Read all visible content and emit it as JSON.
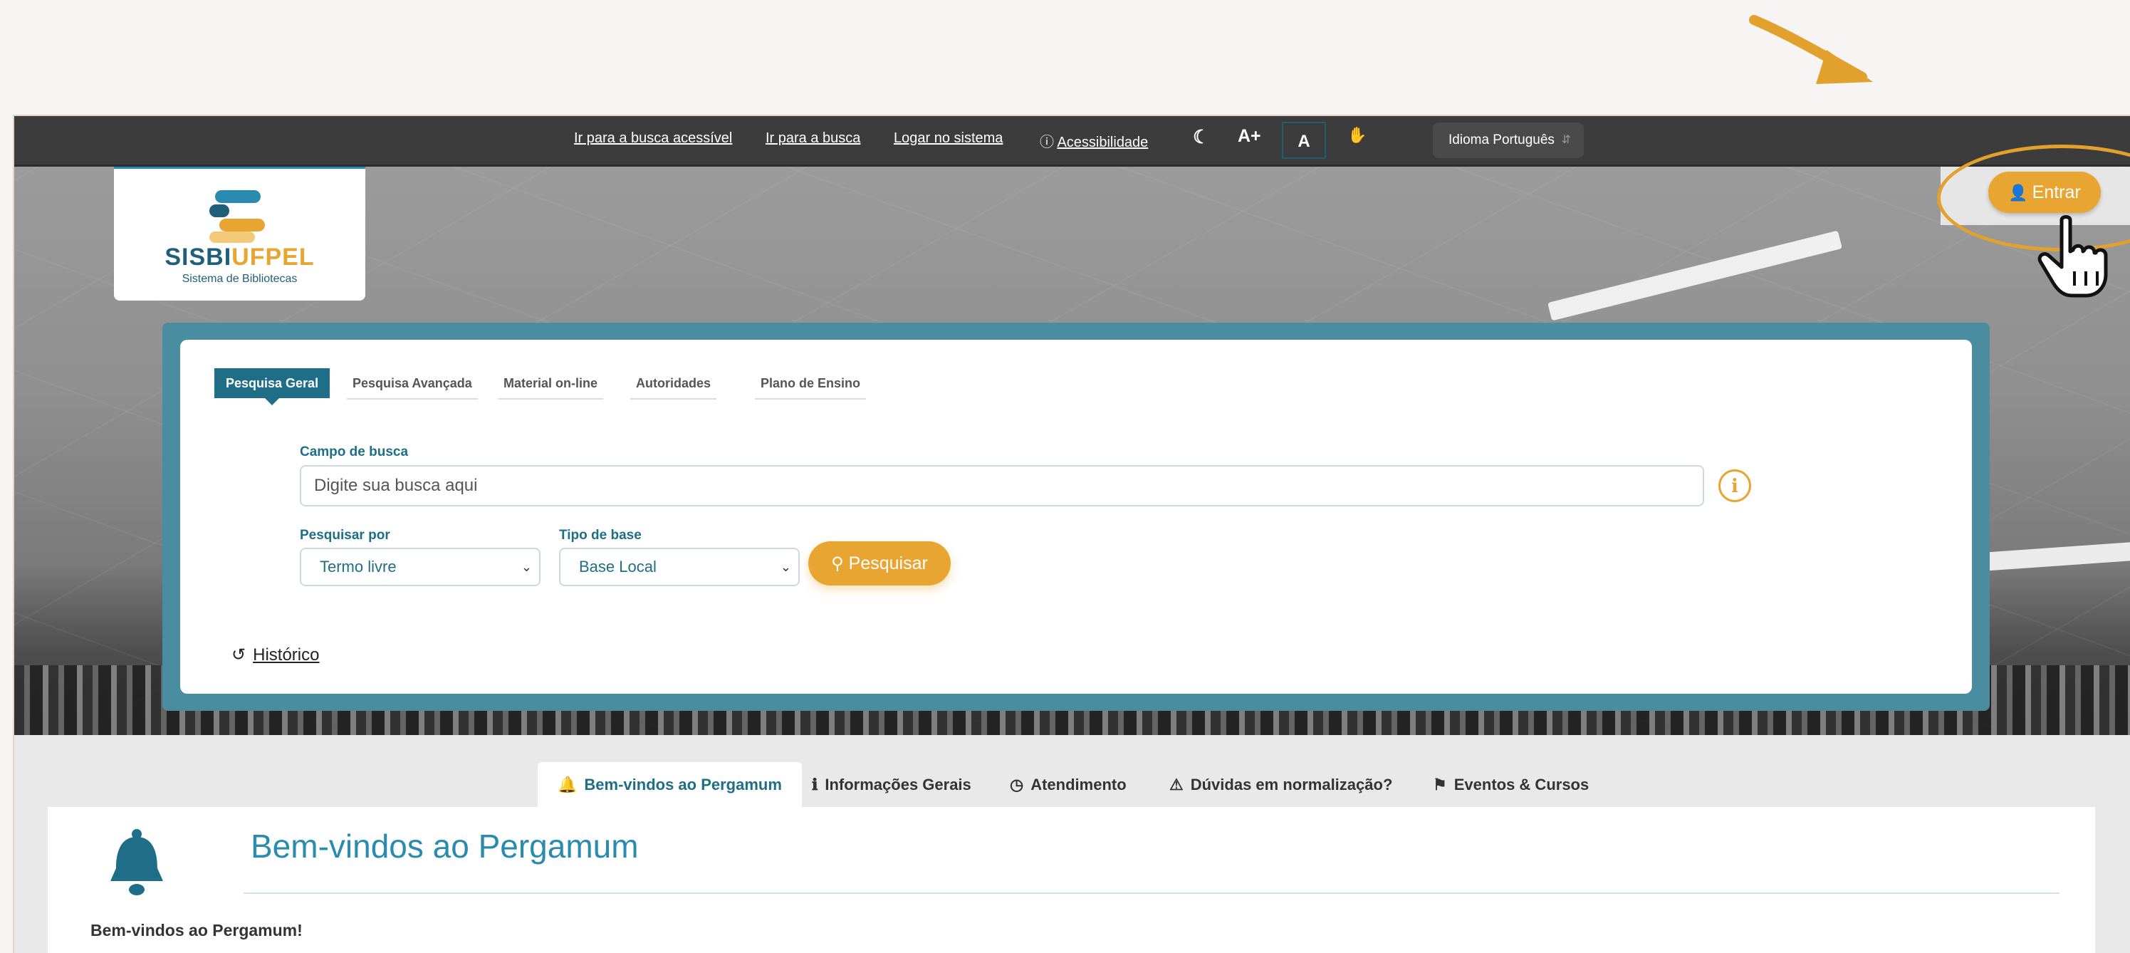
{
  "topbar": {
    "links": [
      "Ir para a busca acessível",
      "Ir para a busca",
      "Logar no sistema",
      "Acessibilidade"
    ],
    "font_increase": "A+",
    "contrast": "A",
    "language": "Idioma Português"
  },
  "logo": {
    "sisbi": "SISBI",
    "ufpel": "UFPEL",
    "subtitle": "Sistema de Bibliotecas"
  },
  "login": {
    "label": "Entrar"
  },
  "search": {
    "tabs": [
      "Pesquisa Geral",
      "Pesquisa Avançada",
      "Material on-line",
      "Autoridades",
      "Plano de Ensino"
    ],
    "field_label": "Campo de busca",
    "placeholder": "Digite sua busca aqui",
    "pesquisar_por_label": "Pesquisar por",
    "pesquisar_por_value": "Termo livre",
    "tipo_base_label": "Tipo de base",
    "tipo_base_value": "Base Local",
    "submit_label": "Pesquisar",
    "historico": "Histórico"
  },
  "info_tabs": [
    "Bem-vindos ao Pergamum",
    "Informações Gerais",
    "Atendimento",
    "Dúvidas em normalização?",
    "Eventos & Cursos"
  ],
  "content": {
    "title": "Bem-vindos ao Pergamum",
    "text": "Bem-vindos ao Pergamum!"
  },
  "colors": {
    "accent": "#e8a531",
    "primary": "#1e6e88",
    "topbar": "#3c3c3c"
  }
}
